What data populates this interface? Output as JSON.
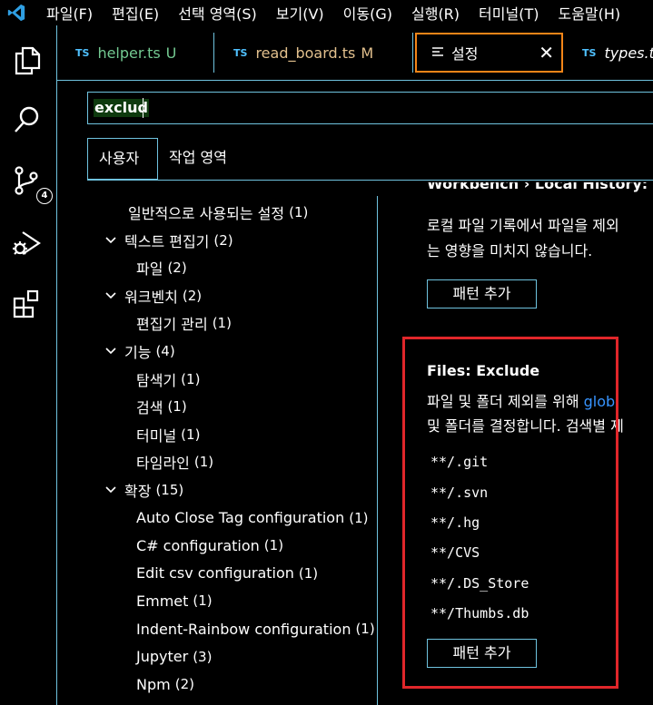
{
  "menu": [
    "파일(F)",
    "편집(E)",
    "선택 영역(S)",
    "보기(V)",
    "이동(G)",
    "실행(R)",
    "터미널(T)",
    "도움말(H)"
  ],
  "tabs": [
    {
      "lang": "TS",
      "name": "helper.ts",
      "status": "U",
      "status_color": "#73c991"
    },
    {
      "lang": "TS",
      "name": "read_board.ts",
      "status": "M",
      "status_color": "#e2c08d"
    },
    {
      "lang": "",
      "name": "설정",
      "status": "",
      "active": true
    },
    {
      "lang": "TS",
      "name": "types.ts",
      "status": ""
    }
  ],
  "activity": {
    "scm_badge": "4"
  },
  "search": {
    "value": "exclud"
  },
  "scopes": {
    "user": "사용자",
    "workspace": "작업 영역"
  },
  "toc": [
    {
      "label": "일반적으로 사용되는 설정",
      "count": "(1)",
      "level": 1,
      "chevron": false
    },
    {
      "label": "텍스트 편집기",
      "count": "(2)",
      "level": 0,
      "chevron": true
    },
    {
      "label": "파일",
      "count": "(2)",
      "level": 1,
      "chevron": false
    },
    {
      "label": "워크벤치",
      "count": "(2)",
      "level": 0,
      "chevron": true
    },
    {
      "label": "편집기 관리",
      "count": "(1)",
      "level": 1,
      "chevron": false
    },
    {
      "label": "기능",
      "count": "(4)",
      "level": 0,
      "chevron": true
    },
    {
      "label": "탐색기",
      "count": "(1)",
      "level": 1,
      "chevron": false
    },
    {
      "label": "검색",
      "count": "(1)",
      "level": 1,
      "chevron": false
    },
    {
      "label": "터미널",
      "count": "(1)",
      "level": 1,
      "chevron": false
    },
    {
      "label": "타임라인",
      "count": "(1)",
      "level": 1,
      "chevron": false
    },
    {
      "label": "확장",
      "count": "(15)",
      "level": 0,
      "chevron": true
    },
    {
      "label": "Auto Close Tag configuration",
      "count": "(1)",
      "level": 1,
      "chevron": false
    },
    {
      "label": "C# configuration",
      "count": "(1)",
      "level": 1,
      "chevron": false
    },
    {
      "label": "Edit csv configuration",
      "count": "(1)",
      "level": 1,
      "chevron": false
    },
    {
      "label": "Emmet",
      "count": "(1)",
      "level": 1,
      "chevron": false
    },
    {
      "label": "Indent-Rainbow configuration",
      "count": "(1)",
      "level": 1,
      "chevron": false
    },
    {
      "label": "Jupyter",
      "count": "(3)",
      "level": 1,
      "chevron": false
    },
    {
      "label": "Npm",
      "count": "(2)",
      "level": 1,
      "chevron": false
    }
  ],
  "local_history": {
    "cut_title": "Workbench › Local History: Ex",
    "desc_line1": "로컬 파일 기록에서 파일을 제외",
    "desc_line2": "는 영향을 미치지 않습니다.",
    "button": "패턴 추가"
  },
  "files_exclude": {
    "title": "Files: Exclude",
    "desc_line1_a": "파일 및 폴더 제외를 위해 ",
    "desc_line1_link": "glob",
    "desc_line2": "및 폴더를 결정합니다. 검색별 제",
    "patterns": [
      "**/.git",
      "**/.svn",
      "**/.hg",
      "**/CVS",
      "**/.DS_Store",
      "**/Thumbs.db"
    ],
    "button": "패턴 추가"
  },
  "colors": {
    "accent": "#6fc3df",
    "focus": "#f38518",
    "highlight": "#e0262a",
    "link": "#3794ff"
  }
}
